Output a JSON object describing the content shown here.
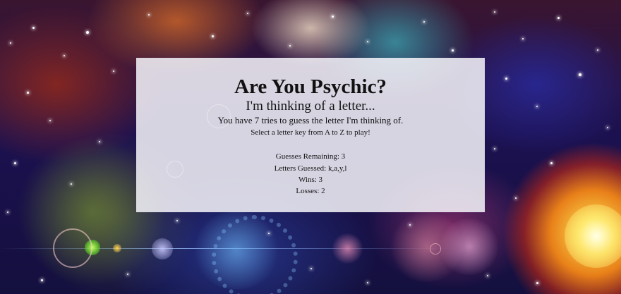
{
  "game": {
    "title": "Are You Psychic?",
    "subtitle": "I'm thinking of a letter...",
    "tries_text": "You have 7 tries to guess the letter I'm thinking of.",
    "instructions": "Select a letter key from A to Z to play!",
    "guesses_remaining_text": "Guesses Remaining: 3",
    "letters_guessed_text": "Letters Guessed: k,a,y,l",
    "wins_text": "Wins: 3",
    "losses_text": "Losses: 2"
  },
  "colors": {
    "card_background": "#f6f4fa",
    "text": "#111111"
  }
}
